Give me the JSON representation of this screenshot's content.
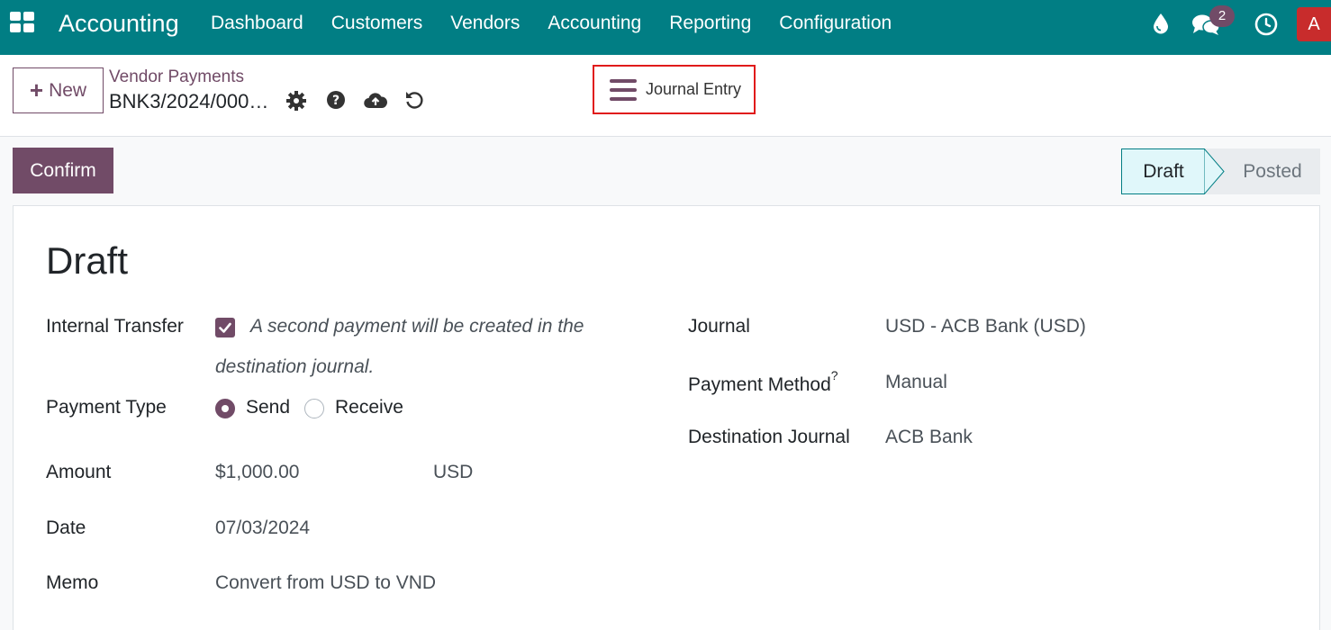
{
  "navbar": {
    "brand": "Accounting",
    "menu": [
      "Dashboard",
      "Customers",
      "Vendors",
      "Accounting",
      "Reporting",
      "Configuration"
    ],
    "chat_badge": "2",
    "avatar_initial": "A",
    "color": "#017e84"
  },
  "control": {
    "new_label": "New",
    "breadcrumb_parent": "Vendor Payments",
    "breadcrumb_current": "BNK3/2024/000…",
    "journal_entry_label": "Journal Entry"
  },
  "actions": {
    "confirm_label": "Confirm",
    "status_steps": [
      "Draft",
      "Posted"
    ],
    "status_active": "Draft"
  },
  "form": {
    "title": "Draft",
    "internal_transfer": {
      "label": "Internal Transfer",
      "checked": true,
      "help_line1": "A second payment will be created in the",
      "help_line2": "destination journal."
    },
    "payment_type": {
      "label": "Payment Type",
      "options": [
        "Send",
        "Receive"
      ],
      "selected": "Send"
    },
    "amount": {
      "label": "Amount",
      "value": "$1,000.00",
      "currency": "USD"
    },
    "date": {
      "label": "Date",
      "value": "07/03/2024"
    },
    "memo": {
      "label": "Memo",
      "value": "Convert from USD to VND"
    },
    "journal": {
      "label": "Journal",
      "value": "USD - ACB Bank (USD)"
    },
    "payment_method": {
      "label": "Payment Method",
      "help_mark": "?",
      "value": "Manual"
    },
    "destination_journal": {
      "label": "Destination Journal",
      "value": "ACB Bank"
    }
  },
  "colors": {
    "accent": "#714b67",
    "highlight_border": "#e01b1b"
  }
}
